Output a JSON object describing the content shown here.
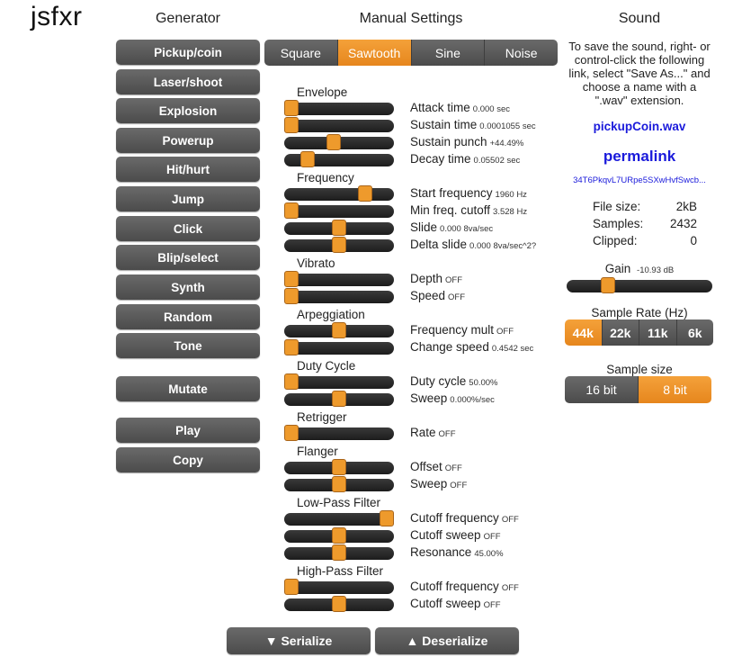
{
  "app": {
    "title": "jsfxr"
  },
  "headings": {
    "generator": "Generator",
    "manual": "Manual Settings",
    "sound": "Sound"
  },
  "generator": {
    "buttons": [
      "Pickup/coin",
      "Laser/shoot",
      "Explosion",
      "Powerup",
      "Hit/hurt",
      "Jump",
      "Click",
      "Blip/select",
      "Synth",
      "Random",
      "Tone"
    ],
    "mutate": "Mutate",
    "play": "Play",
    "copy": "Copy"
  },
  "wave": {
    "tabs": [
      "Square",
      "Sawtooth",
      "Sine",
      "Noise"
    ],
    "active": "Sawtooth"
  },
  "sections": [
    "Envelope",
    "Frequency",
    "Vibrato",
    "Arpeggiation",
    "Duty Cycle",
    "Retrigger",
    "Flanger",
    "Low-Pass Filter",
    "High-Pass Filter"
  ],
  "sliders": [
    {
      "label": "Attack time",
      "value": "0.000 sec",
      "level": 0.0
    },
    {
      "label": "Sustain time",
      "value": "0.0001055 sec",
      "level": 0.0
    },
    {
      "label": "Sustain punch",
      "value": "+44.49%",
      "level": 0.44
    },
    {
      "label": "Decay time",
      "value": "0.05502 sec",
      "level": 0.17
    },
    {
      "label": "Start frequency",
      "value": "1960 Hz",
      "level": 0.77
    },
    {
      "label": "Min freq. cutoff",
      "value": "3.528 Hz",
      "level": 0.0
    },
    {
      "label": "Slide",
      "value": "0.000 8va/sec",
      "level": 0.5
    },
    {
      "label": "Delta slide",
      "value": "0.000 8va/sec^2?",
      "level": 0.5
    },
    {
      "label": "Depth",
      "value": "OFF",
      "level": 0.0
    },
    {
      "label": "Speed",
      "value": "OFF",
      "level": 0.0
    },
    {
      "label": "Frequency mult",
      "value": "OFF",
      "level": 0.5
    },
    {
      "label": "Change speed",
      "value": "0.4542 sec",
      "level": 0.0
    },
    {
      "label": "Duty cycle",
      "value": "50.00%",
      "level": 0.0
    },
    {
      "label": "Sweep",
      "value": "0.000%/sec",
      "level": 0.5
    },
    {
      "label": "Rate",
      "value": "OFF",
      "level": 0.0
    },
    {
      "label": "Offset",
      "value": "OFF",
      "level": 0.5
    },
    {
      "label": "Sweep",
      "value": "OFF",
      "level": 0.5
    },
    {
      "label": "Cutoff frequency",
      "value": "OFF",
      "level": 1.0
    },
    {
      "label": "Cutoff sweep",
      "value": "OFF",
      "level": 0.5
    },
    {
      "label": "Resonance",
      "value": "45.00%",
      "level": 0.5
    },
    {
      "label": "Cutoff frequency",
      "value": "OFF",
      "level": 0.0
    },
    {
      "label": "Cutoff sweep",
      "value": "OFF",
      "level": 0.5
    }
  ],
  "sound": {
    "save_text": "To save the sound, right- or control-click the following link, select \"Save As...\" and choose a name with a \".wav\" extension.",
    "wav_link": "pickupCoin.wav",
    "permalink": "permalink",
    "permalink_code": "34T6PkqvL7URpe5SXwHvfSwcb...",
    "stats": [
      {
        "label": "File size:",
        "value": "2kB"
      },
      {
        "label": "Samples:",
        "value": "2432"
      },
      {
        "label": "Clipped:",
        "value": "0"
      }
    ],
    "gain_label": "Gain",
    "gain_value": "-10.93 dB",
    "gain_level": 0.26,
    "rate_title": "Sample Rate (Hz)",
    "rates": [
      "44k",
      "22k",
      "11k",
      "6k"
    ],
    "rate_active": "44k",
    "size_title": "Sample size",
    "sizes": [
      "16 bit",
      "8 bit"
    ],
    "size_active": "8 bit"
  },
  "bottom": {
    "serialize": "▼ Serialize",
    "deserialize": "▲ Deserialize"
  },
  "colors": {
    "accent": "#ee9a2c",
    "button": "#555555",
    "link": "#1a1adb"
  }
}
